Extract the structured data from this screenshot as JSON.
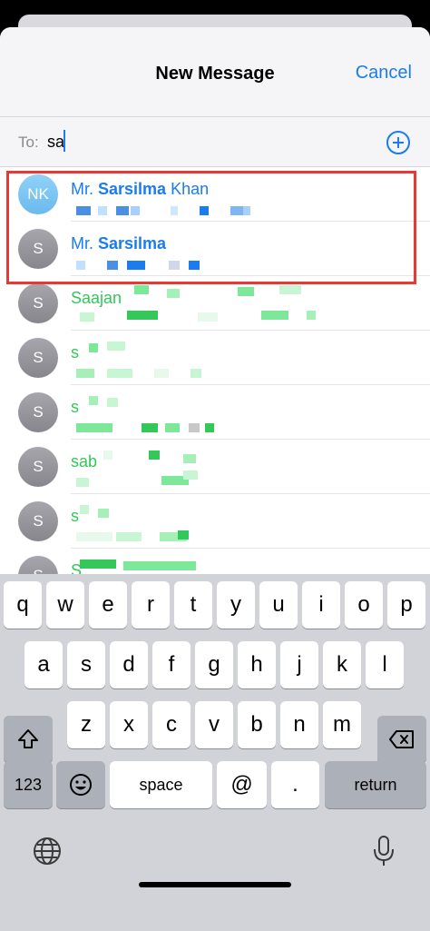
{
  "header": {
    "title": "New Message",
    "cancel_label": "Cancel"
  },
  "recipient": {
    "label": "To:",
    "value": "sa"
  },
  "contacts": [
    {
      "initials": "NK",
      "prefix": "Mr. ",
      "bold": "Sarsilma",
      "suffix": " Khan",
      "style": "blue",
      "avatar": "blue"
    },
    {
      "initials": "S",
      "prefix": "Mr. ",
      "bold": "Sarsilma",
      "suffix": "",
      "style": "blue",
      "avatar": "gray"
    },
    {
      "initials": "S",
      "prefix": "Saajan",
      "bold": "",
      "suffix": "",
      "style": "green",
      "avatar": "gray"
    },
    {
      "initials": "S",
      "prefix": "s",
      "bold": "",
      "suffix": "",
      "style": "green",
      "avatar": "gray"
    },
    {
      "initials": "S",
      "prefix": "s",
      "bold": "",
      "suffix": "",
      "style": "green",
      "avatar": "gray"
    },
    {
      "initials": "S",
      "prefix": "sab",
      "bold": "",
      "suffix": "",
      "style": "green",
      "avatar": "gray"
    },
    {
      "initials": "S",
      "prefix": "s",
      "bold": "",
      "suffix": "",
      "style": "green",
      "avatar": "gray"
    },
    {
      "initials": "S",
      "prefix": "S",
      "bold": "",
      "suffix": "",
      "style": "green",
      "avatar": "gray"
    }
  ],
  "keyboard": {
    "row1": [
      "q",
      "w",
      "e",
      "r",
      "t",
      "y",
      "u",
      "i",
      "o",
      "p"
    ],
    "row2": [
      "a",
      "s",
      "d",
      "f",
      "g",
      "h",
      "j",
      "k",
      "l"
    ],
    "row3": [
      "z",
      "x",
      "c",
      "v",
      "b",
      "n",
      "m"
    ],
    "numbers_label": "123",
    "space_label": "space",
    "at_label": "@",
    "dot_label": ".",
    "return_label": "return"
  },
  "colors": {
    "accent": "#1a7cf0",
    "highlight": "#e53935",
    "contact_green": "#34c759"
  }
}
